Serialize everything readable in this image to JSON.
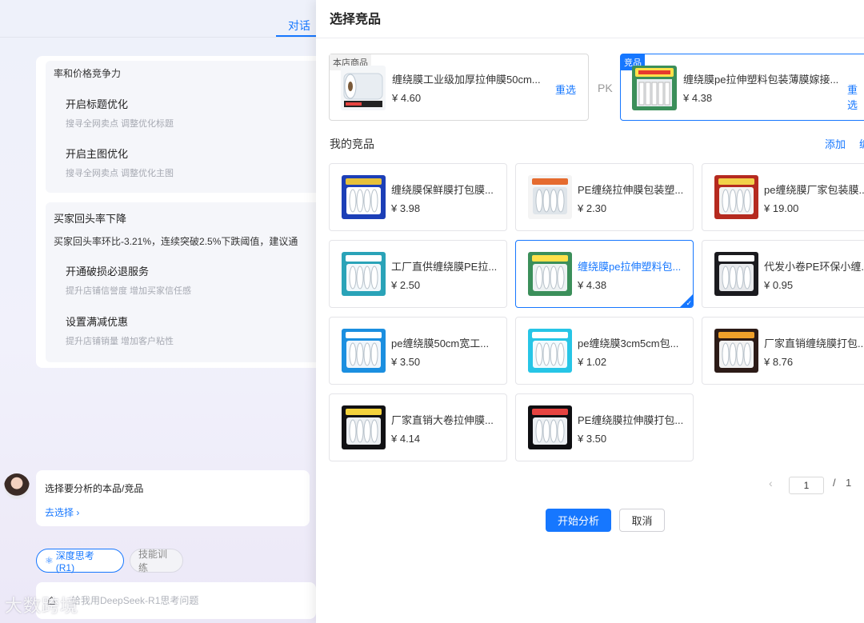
{
  "background": {
    "tab_label": "对话",
    "card1": {
      "section1_title": "率和价格竞争力",
      "items1": [
        {
          "title": "开启标题优化",
          "desc": "搜寻全网卖点 调整优化标题"
        },
        {
          "title": "开启主图优化",
          "desc": "搜寻全网卖点 调整优化主图"
        }
      ],
      "section2_title": "买家回头率下降",
      "section2_desc": "买家回头率环比-3.21%，连续突破2.5%下跌阈值，建议通",
      "items2": [
        {
          "title": "开通破损必退服务",
          "desc": "提升店铺信誉度 增加买家信任感"
        },
        {
          "title": "设置满减优惠",
          "desc": "提升店铺销量 增加客户粘性"
        }
      ]
    },
    "card2": {
      "title": "选择要分析的本品/竞品",
      "link": "去选择 ›"
    },
    "pills": {
      "deep": "深度思考 (R1)",
      "skill": "技能训练"
    },
    "input_placeholder": "给我用DeepSeek-R1思考问题",
    "watermark": "大数跨境"
  },
  "drawer": {
    "title": "选择竞品",
    "own": {
      "tag": "本店商品",
      "name": "缠绕膜工业级加厚拉伸膜50cm...",
      "price": "¥ 4.60",
      "reset": "重选"
    },
    "pk": "PK",
    "competitor": {
      "tag": "竞品",
      "name": "缠绕膜pe拉伸塑料包装薄膜嫁接...",
      "price": "¥ 4.38",
      "reset": "重选"
    },
    "mine_label": "我的竞品",
    "add_label": "添加",
    "edge_label": "编",
    "products": [
      {
        "name": "缠绕膜保鲜膜打包膜...",
        "price": "¥ 3.98",
        "thumb": "blue-roll"
      },
      {
        "name": "PE缠绕拉伸膜包装塑...",
        "price": "¥ 2.30",
        "thumb": "white-rolls"
      },
      {
        "name": "pe缠绕膜厂家包装膜...",
        "price": "¥ 19.00",
        "thumb": "red-rolls"
      },
      {
        "name": "工厂直供缠绕膜PE拉...",
        "price": "¥ 2.50",
        "thumb": "teal-rolls"
      },
      {
        "name": "缠绕膜pe拉伸塑料包...",
        "price": "¥ 4.38",
        "thumb": "green-rolls",
        "selected": true
      },
      {
        "name": "代发小卷PE环保小缠...",
        "price": "¥ 0.95",
        "thumb": "dark-rolls"
      },
      {
        "name": "pe缠绕膜50cm宽工...",
        "price": "¥ 3.50",
        "thumb": "blue-stack"
      },
      {
        "name": "pe缠绕膜3cm5cm包...",
        "price": "¥ 1.02",
        "thumb": "cyan-rolls"
      },
      {
        "name": "厂家直销缠绕膜打包...",
        "price": "¥ 8.76",
        "thumb": "orange-rolls"
      },
      {
        "name": "厂家直销大卷拉伸膜...",
        "price": "¥ 4.14",
        "thumb": "black-rolls"
      },
      {
        "name": "PE缠绕膜拉伸膜打包...",
        "price": "¥ 3.50",
        "thumb": "black-rolls2"
      }
    ],
    "pagination": {
      "prev": "‹",
      "current": "1",
      "sep": "/",
      "total": "1"
    },
    "buttons": {
      "start": "开始分析",
      "cancel": "取消"
    },
    "colors": {
      "accent": "#1677ff",
      "text": "#333333",
      "border": "#e4e4e8"
    }
  }
}
